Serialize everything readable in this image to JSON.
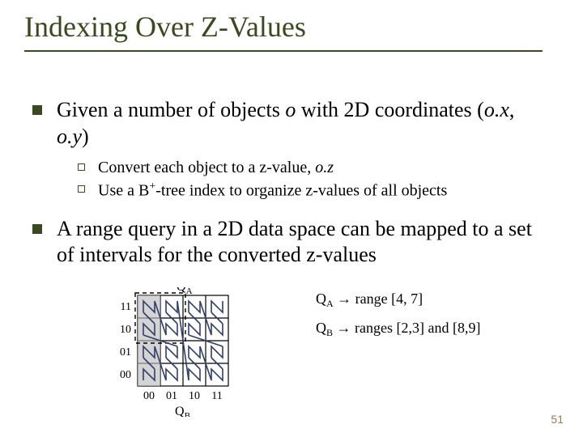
{
  "title": "Indexing Over Z-Values",
  "bullets": {
    "b1_pre": "Given a number of objects ",
    "b1_o": "o",
    "b1_mid": " with 2D coordinates (",
    "b1_ox": "o.x",
    "b1_comma": ", ",
    "b1_oy": "o.y",
    "b1_end": ")",
    "s1_pre": "Convert each object to a z-value, ",
    "s1_oz": "o.z",
    "s2_pre": "Use a B",
    "s2_sup": "+",
    "s2_post": "-tree index to organize z-values of all objects",
    "b2": "A range query in a 2D data space can be mapped to a set of intervals for the converted z-values"
  },
  "figure": {
    "qa_label": "Q",
    "qa_sub": "A",
    "qb_label": "Q",
    "qb_sub": "B",
    "y_ticks": [
      "11",
      "10",
      "01",
      "00"
    ],
    "x_ticks": [
      "00",
      "01",
      "10",
      "11"
    ],
    "right1_pre": "Q",
    "right1_sub": "A",
    "right1_post": " → range [4, 7]",
    "right2_pre": "Q",
    "right2_sub": "B",
    "right2_post": " → ranges [2,3] and [8,9]"
  },
  "page_number": "51"
}
